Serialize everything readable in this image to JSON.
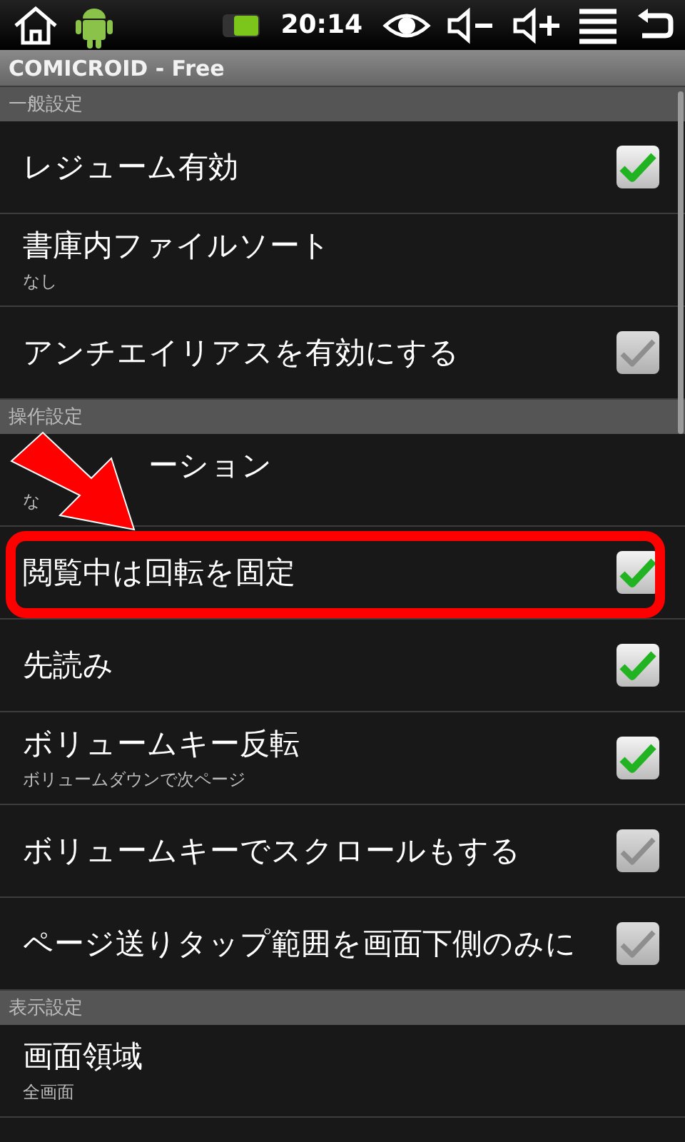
{
  "status_bar": {
    "time": "20:14"
  },
  "window": {
    "title": "COMICROID - Free"
  },
  "sections": [
    {
      "header": "一般設定",
      "items": [
        {
          "kind": "checkbox",
          "title": "レジューム有効",
          "checked": true,
          "disabled": false
        },
        {
          "kind": "list",
          "title": "書庫内ファイルソート",
          "summary": "なし"
        },
        {
          "kind": "checkbox",
          "title": "アンチエイリアスを有効にする",
          "checked": true,
          "disabled": true
        }
      ]
    },
    {
      "header": "操作設定",
      "items": [
        {
          "kind": "list",
          "title": "ーション",
          "summary": "な",
          "covered": true
        },
        {
          "kind": "checkbox",
          "title": "閲覧中は回転を固定",
          "checked": true,
          "disabled": false,
          "highlighted": true
        },
        {
          "kind": "checkbox",
          "title": "先読み",
          "checked": true,
          "disabled": false
        },
        {
          "kind": "checkbox",
          "title": "ボリュームキー反転",
          "summary": "ボリュームダウンで次ページ",
          "checked": true,
          "disabled": false
        },
        {
          "kind": "checkbox",
          "title": "ボリュームキーでスクロールもする",
          "checked": true,
          "disabled": true
        },
        {
          "kind": "checkbox",
          "title": "ページ送りタップ範囲を画面下側のみに",
          "checked": true,
          "disabled": true
        }
      ]
    },
    {
      "header": "表示設定",
      "items": [
        {
          "kind": "list",
          "title": "画面領域",
          "summary": "全画面"
        }
      ]
    }
  ]
}
